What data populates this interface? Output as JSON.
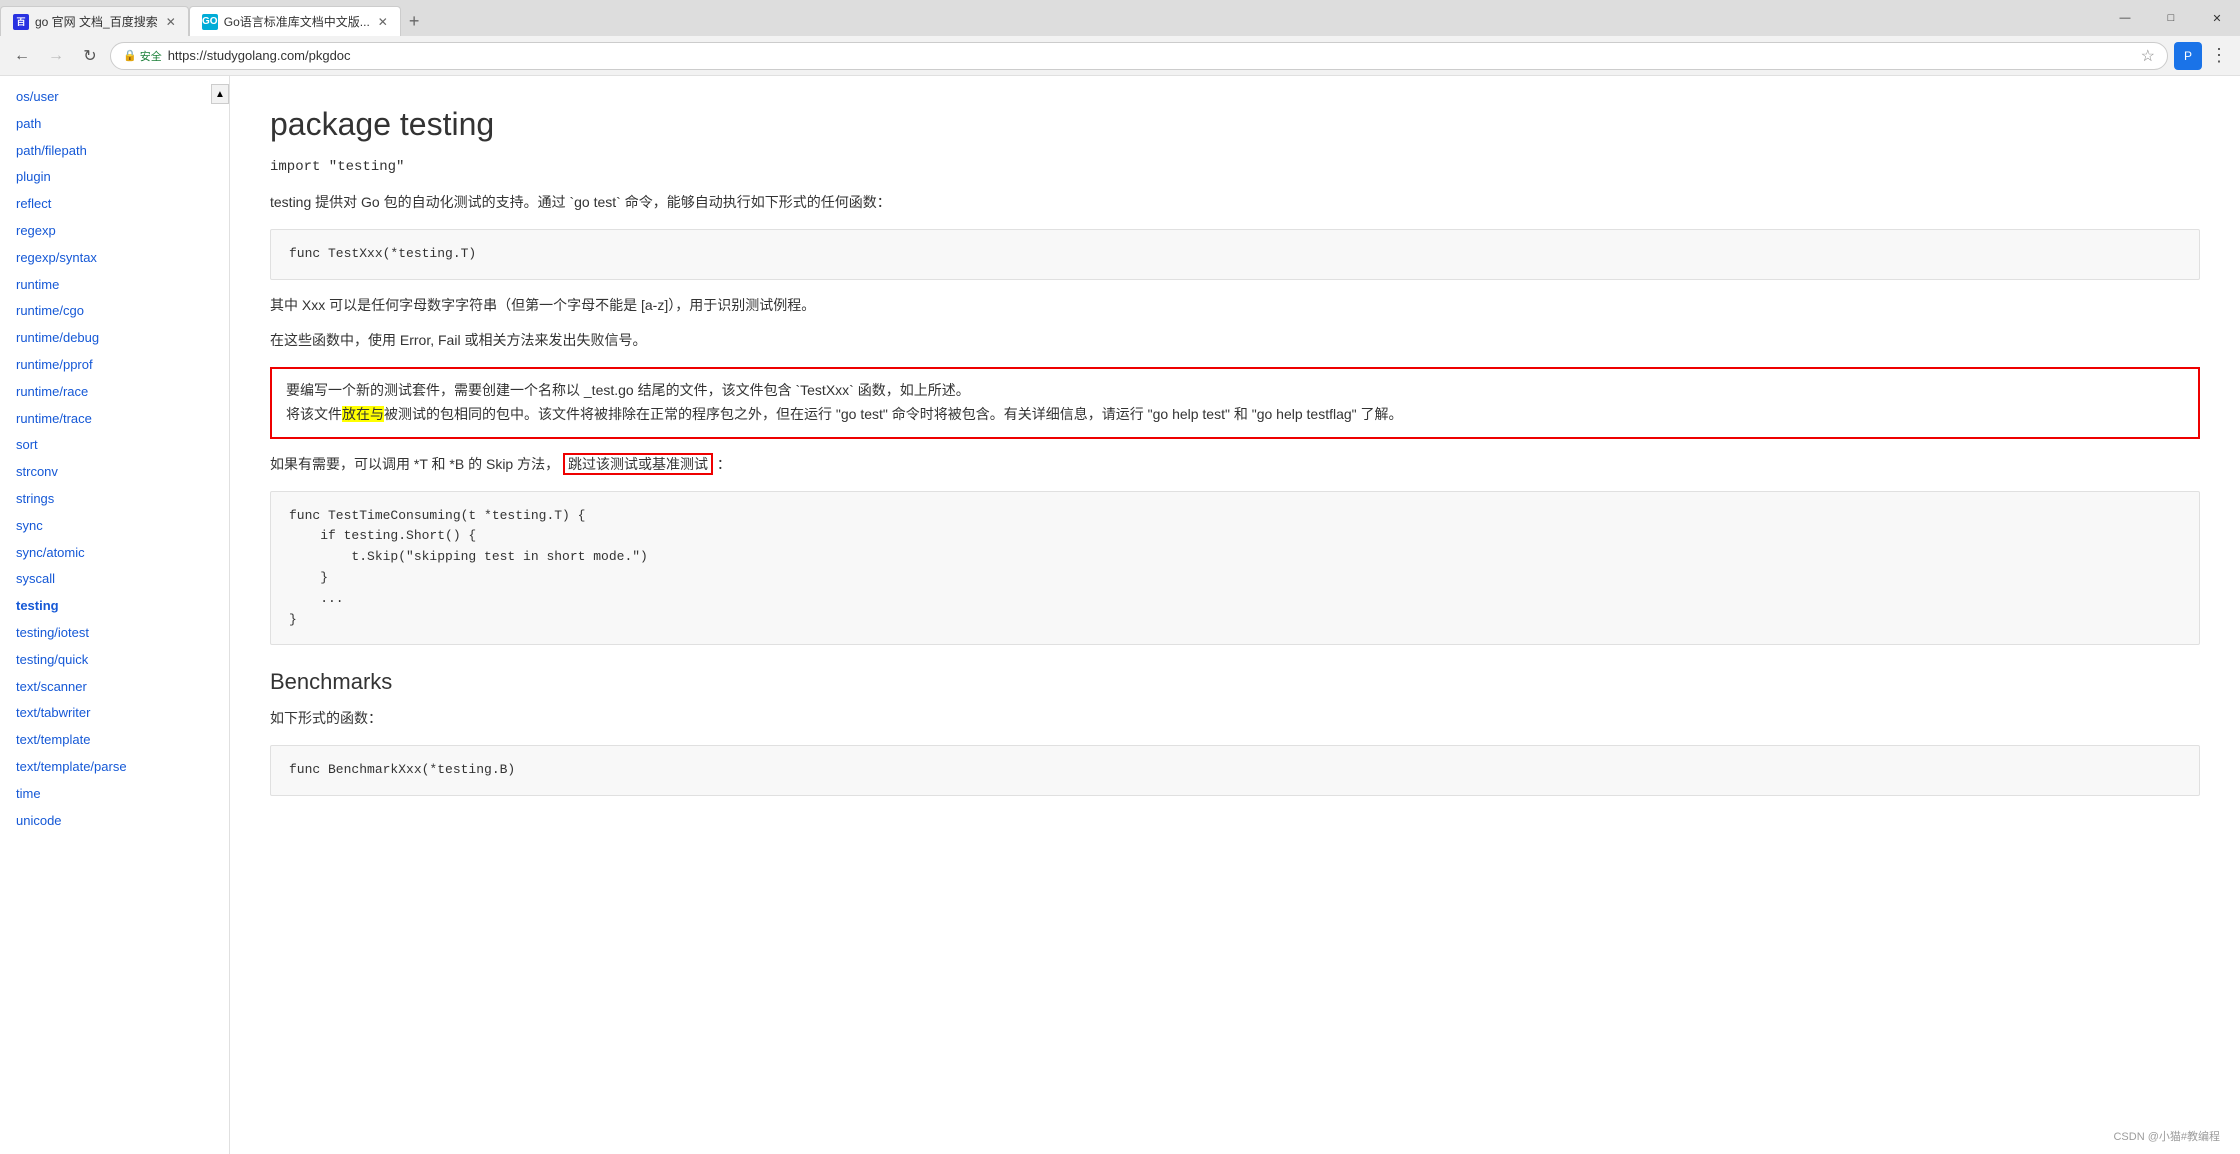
{
  "browser": {
    "tabs": [
      {
        "id": "tab1",
        "favicon_type": "baidu",
        "favicon_text": "百",
        "label": "go 官网 文档_百度搜索",
        "active": false,
        "closable": true
      },
      {
        "id": "tab2",
        "favicon_type": "go",
        "favicon_text": "GO",
        "label": "Go语言标准库文档中文版...",
        "active": true,
        "closable": true
      }
    ],
    "nav": {
      "back_disabled": false,
      "forward_disabled": true,
      "reload_label": "↻",
      "secure_label": "安全",
      "url": "https://studygolang.com/pkgdoc",
      "star_label": "☆"
    }
  },
  "sidebar": {
    "scroll_up_label": "▲",
    "items": [
      {
        "label": "os/user",
        "href": "#",
        "active": false
      },
      {
        "label": "path",
        "href": "#",
        "active": false
      },
      {
        "label": "path/filepath",
        "href": "#",
        "active": false
      },
      {
        "label": "plugin",
        "href": "#",
        "active": false
      },
      {
        "label": "reflect",
        "href": "#",
        "active": false
      },
      {
        "label": "regexp",
        "href": "#",
        "active": false
      },
      {
        "label": "regexp/syntax",
        "href": "#",
        "active": false
      },
      {
        "label": "runtime",
        "href": "#",
        "active": false
      },
      {
        "label": "runtime/cgo",
        "href": "#",
        "active": false
      },
      {
        "label": "runtime/debug",
        "href": "#",
        "active": false
      },
      {
        "label": "runtime/pprof",
        "href": "#",
        "active": false
      },
      {
        "label": "runtime/race",
        "href": "#",
        "active": false
      },
      {
        "label": "runtime/trace",
        "href": "#",
        "active": false
      },
      {
        "label": "sort",
        "href": "#",
        "active": false
      },
      {
        "label": "strconv",
        "href": "#",
        "active": false
      },
      {
        "label": "strings",
        "href": "#",
        "active": false
      },
      {
        "label": "sync",
        "href": "#",
        "active": false
      },
      {
        "label": "sync/atomic",
        "href": "#",
        "active": false
      },
      {
        "label": "syscall",
        "href": "#",
        "active": false
      },
      {
        "label": "testing",
        "href": "#",
        "active": true
      },
      {
        "label": "testing/iotest",
        "href": "#",
        "active": false
      },
      {
        "label": "testing/quick",
        "href": "#",
        "active": false
      },
      {
        "label": "text/scanner",
        "href": "#",
        "active": false
      },
      {
        "label": "text/tabwriter",
        "href": "#",
        "active": false
      },
      {
        "label": "text/template",
        "href": "#",
        "active": false
      },
      {
        "label": "text/template/parse",
        "href": "#",
        "active": false
      },
      {
        "label": "time",
        "href": "#",
        "active": false
      },
      {
        "label": "unicode",
        "href": "#",
        "active": false
      }
    ]
  },
  "main": {
    "package_title": "package testing",
    "import_statement": "import \"testing\"",
    "description1": "testing 提供对 Go 包的自动化测试的支持。通过 `go test` 命令，能够自动执行如下形式的任何函数：",
    "code1": "func TestXxx(*testing.T)",
    "description2": "其中 Xxx 可以是任何字母数字字符串（但第一个字母不能是 [a-z]），用于识别测试例程。",
    "description3": "在这些函数中，使用 Error, Fail 或相关方法来发出失败信号。",
    "highlighted_text": "要编写一个新的测试套件，需要创建一个名称以 _test.go 结尾的文件，该文件包含 `TestXxx` 函数，如上所述。将该文件放在与被测试的包相同的包中。该文件将被排除在正常的程序包之外，但在运行 \"go test\" 命令时将被包含。有关详细信息，请运行 \"go help test\" 和 \"go help testflag\" 了解。",
    "highlight_part1": "将该文件",
    "highlight_part2": "放在与",
    "description4": "如果有需要，可以调用 *T 和 *B 的 Skip 方法，",
    "inline_red_text": "跳过该测试或基准测试",
    "description4_end": "：",
    "code2_lines": [
      "func TestTimeConsuming(t *testing.T) {",
      "    if testing.Short() {",
      "        t.Skip(\"skipping test in short mode.\")",
      "    }",
      "    ...",
      "}"
    ],
    "benchmarks_title": "Benchmarks",
    "benchmarks_desc": "如下形式的函数：",
    "code3": "func BenchmarkXxx(*testing.B)"
  },
  "window_controls": {
    "minimize": "—",
    "maximize": "□",
    "close": "✕"
  },
  "csdn_watermark": "CSDN @小猫#教编程"
}
